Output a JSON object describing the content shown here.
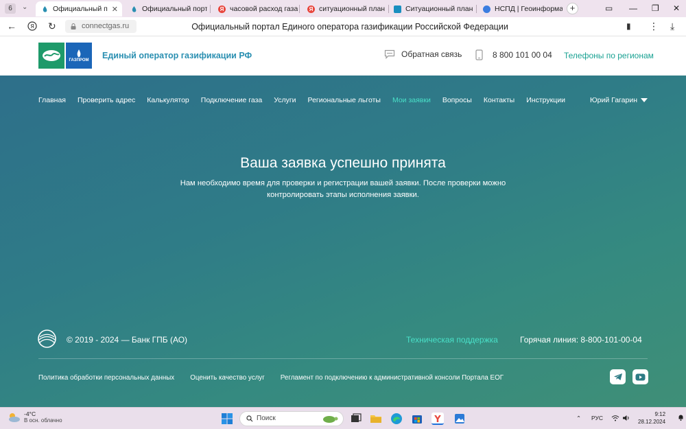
{
  "browser": {
    "tab_count": "6",
    "tabs": [
      {
        "title": "Официальный портал",
        "favicon_color": "#2a8fb1",
        "active": true
      },
      {
        "title": "Официальный портал Е",
        "favicon_color": "#2a8fb1",
        "active": false
      },
      {
        "title": "часовой расход газа д",
        "favicon_color": "#e8453c",
        "active": false
      },
      {
        "title": "ситуационный план дл",
        "favicon_color": "#e8453c",
        "active": false
      },
      {
        "title": "Ситуационный план дл",
        "favicon_color": "#1a8fbf",
        "active": false
      },
      {
        "title": "НСПД | Геоинформаци",
        "favicon_color": "#3b7de0",
        "active": false
      }
    ],
    "url": "connectgas.ru",
    "page_title": "Официальный портал Единого оператора газификации Российской Федерации"
  },
  "header": {
    "brand_name": "Единый оператор газификации РФ",
    "logo_text": "ГАЗПРОМ",
    "feedback": "Обратная связь",
    "phone": "8 800 101 00 04",
    "regions": "Телефоны по регионам"
  },
  "nav": {
    "items": [
      "Главная",
      "Проверить адрес",
      "Калькулятор",
      "Подключение газа",
      "Услуги",
      "Региональные льготы",
      "Мои заявки",
      "Вопросы",
      "Контакты",
      "Инструкции"
    ],
    "active_index": 6,
    "user": "Юрий Гагарин"
  },
  "message": {
    "title": "Ваша заявка успешно принята",
    "text": "Нам необходимо время для проверки и регистрации вашей заявки. После проверки можно контролировать этапы исполнения заявки."
  },
  "footer": {
    "copyright": "© 2019 - 2024 — Банк ГПБ (АО)",
    "support": "Техническая поддержка",
    "hotline": "Горячая линия:  8-800-101-00-04",
    "links": [
      "Политика обработки персональных данных",
      "Оценить качество услуг",
      "Регламент по подключению к административной консоли Портала ЕОГ"
    ]
  },
  "taskbar": {
    "temperature": "-4°C",
    "weather": "В осн. облачно",
    "search": "Поиск",
    "lang": "РУС",
    "time": "9:12",
    "date": "28.12.2024"
  },
  "colors": {
    "accent": "#49e0c8",
    "brand": "#2a8fb1",
    "gradient_start": "#2e6f8a",
    "gradient_end": "#3f8f77"
  }
}
